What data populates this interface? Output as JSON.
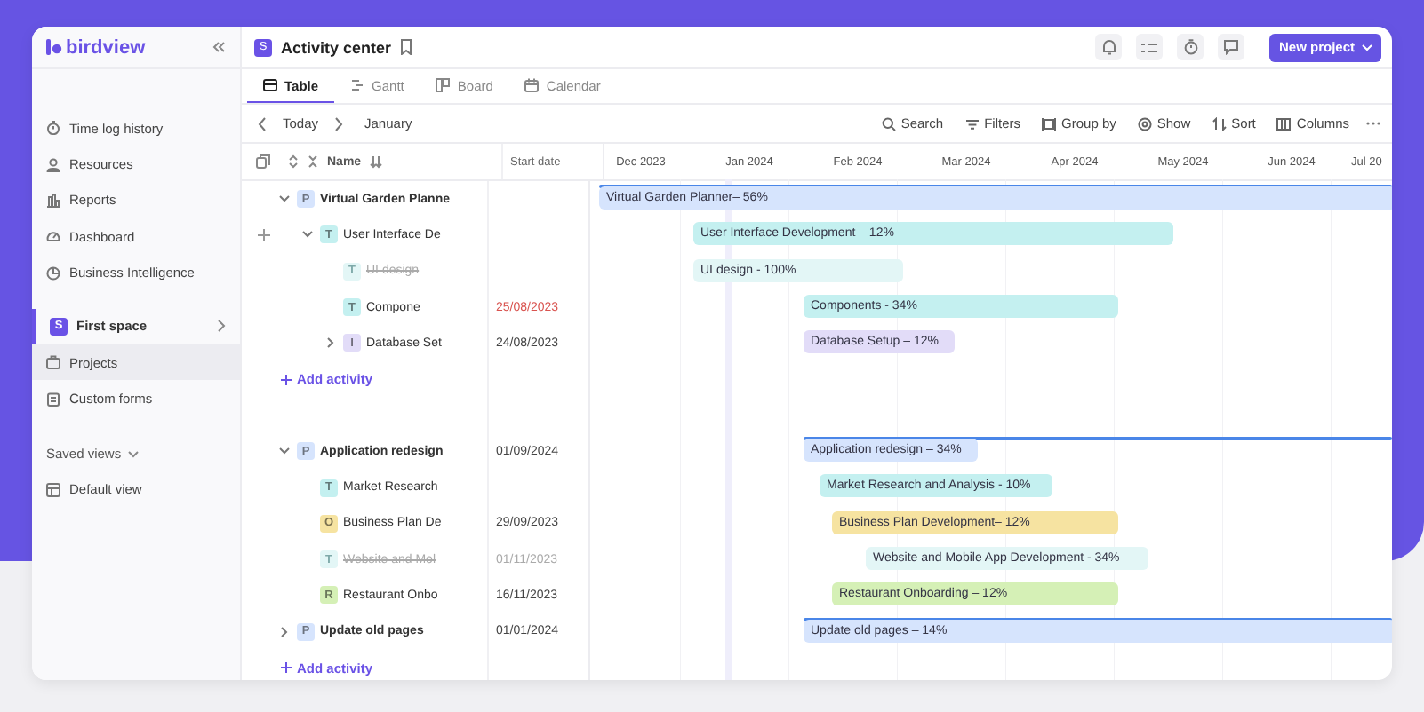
{
  "sidebar": {
    "logo": "birdview",
    "nav": [
      {
        "label": "Time log history",
        "selected": false
      },
      {
        "label": "Resources",
        "selected": false
      },
      {
        "label": "Reports",
        "selected": false
      },
      {
        "label": "Dashboard",
        "selected": false
      },
      {
        "label": "Business Intelligence",
        "selected": false
      }
    ],
    "space": {
      "badge": "S",
      "label": "First space"
    },
    "space_items": [
      {
        "label": "Projects",
        "selected": true
      },
      {
        "label": "Custom forms",
        "selected": false
      }
    ],
    "saved_views": {
      "label": "Saved views",
      "items": [
        {
          "label": "Default view",
          "selected": false
        }
      ]
    }
  },
  "header": {
    "space_badge": "S",
    "title": "Activity center",
    "new_button": "New project"
  },
  "tabs": [
    {
      "label": "Table",
      "selected": true
    },
    {
      "label": "Gantt",
      "selected": false
    },
    {
      "label": "Board",
      "selected": false
    },
    {
      "label": "Calendar",
      "selected": false
    }
  ],
  "toolbar": {
    "today": "Today",
    "period": "January",
    "actions": [
      "Search",
      "Filters",
      "Group by",
      "Show",
      "Sort",
      "Columns"
    ]
  },
  "table": {
    "columns": [
      "Name",
      "Start date"
    ],
    "months": [
      "Dec 2023",
      "Jan 2024",
      "Feb 2024",
      "Mar 2024",
      "Apr 2024",
      "May 2024",
      "Jun 2024",
      "Jul 20"
    ],
    "groups": [
      {
        "items": [
          {
            "name": "Virtual Garden Planne",
            "kind": "project",
            "badge": "P",
            "color": "#d6e4fd",
            "expandable": true,
            "expanded": true,
            "done": false,
            "hovered": false,
            "bar": "Virtual Garden Planner– 56%",
            "children": [
              {
                "name": "User Interface De",
                "kind": "task",
                "badge": "T",
                "color": "#c4f0f0",
                "expandable": true,
                "expanded": true,
                "done": false,
                "hovered": true,
                "bar": "User Interface Development – 12%",
                "children": [
                  {
                    "name": "UI design",
                    "kind": "task",
                    "badge": "T",
                    "color": "#e3f6f6",
                    "expandable": false,
                    "done": true,
                    "hovered": false,
                    "bar": "UI design - 100%"
                  },
                  {
                    "name": "Compone",
                    "kind": "task",
                    "badge": "T",
                    "color": "#c4f0f0",
                    "expandable": false,
                    "done": false,
                    "hovered": false,
                    "date": "25/08/2023",
                    "overdue": true,
                    "bar": "Components - 34%"
                  },
                  {
                    "name": "Database Set",
                    "kind": "task",
                    "badge": "I",
                    "color": "#e2dcf8",
                    "expandable": true,
                    "expanded": false,
                    "done": false,
                    "hovered": false,
                    "date": "24/08/2023",
                    "overdue": false,
                    "bar": "Database Setup – 12%"
                  }
                ]
              }
            ]
          }
        ],
        "add": "Add activity"
      },
      {
        "items": [
          {
            "name": "Application redesign",
            "kind": "project",
            "badge": "P",
            "color": "#d6e4fd",
            "expandable": true,
            "expanded": true,
            "done": false,
            "hovered": false,
            "date": "01/09/2024",
            "overdue": false,
            "bar": "Application redesign – 34%",
            "children": [
              {
                "name": "Market Research",
                "kind": "task",
                "badge": "T",
                "color": "#c4f0f0",
                "expandable": false,
                "done": false,
                "hovered": false,
                "bar": "Market Research and Analysis - 10%"
              },
              {
                "name": "Business Plan De",
                "kind": "task",
                "badge": "O",
                "color": "#f6e3a1",
                "expandable": false,
                "done": false,
                "hovered": false,
                "date": "29/09/2023",
                "overdue": false,
                "bar": "Business Plan Development– 12%"
              },
              {
                "name": "Website and Mol",
                "kind": "task",
                "badge": "T",
                "color": "#e3f6f6",
                "expandable": false,
                "done": true,
                "hovered": false,
                "date": "01/11/2023",
                "overdue": false,
                "bar": "Website and Mobile App Development - 34%"
              },
              {
                "name": "Restaurant Onbo",
                "kind": "task",
                "badge": "R",
                "color": "#d5f0b6",
                "expandable": false,
                "done": false,
                "hovered": false,
                "date": "16/11/2023",
                "overdue": false,
                "bar": "Restaurant Onboarding – 12%"
              }
            ]
          },
          {
            "name": "Update old pages",
            "kind": "project",
            "badge": "P",
            "color": "#d6e4fd",
            "expandable": true,
            "expanded": false,
            "done": false,
            "hovered": false,
            "date": "01/01/2024",
            "overdue": false,
            "bar": "Update old pages – 14%"
          }
        ],
        "add": "Add activity"
      }
    ]
  }
}
